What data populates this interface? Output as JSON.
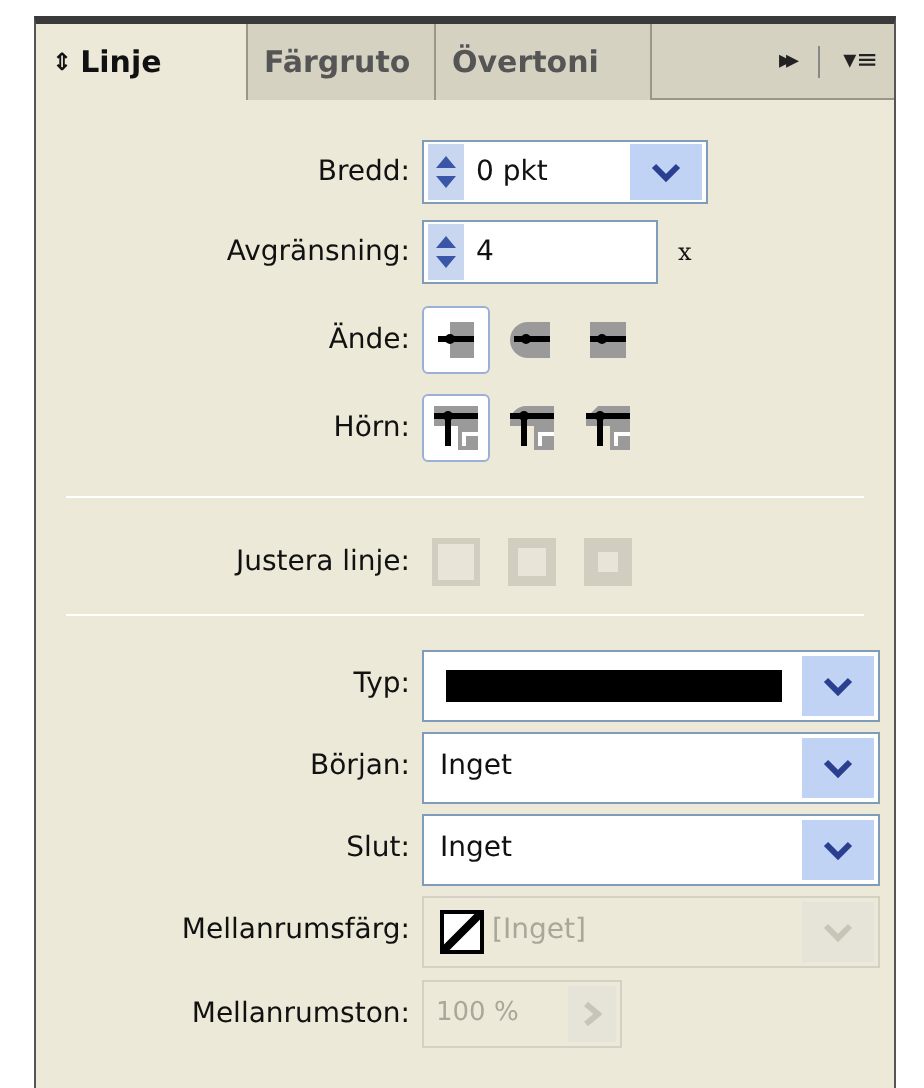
{
  "tabs": [
    {
      "label": "Linje",
      "selected": true,
      "icon": "⇕"
    },
    {
      "label": "Färgruto",
      "selected": false
    },
    {
      "label": "Övertoni",
      "selected": false
    }
  ],
  "tab_bar_icons": {
    "more": "▸▸",
    "menu": "▾≡"
  },
  "width": {
    "label": "Bredd:",
    "value": "0 pkt"
  },
  "miter": {
    "label": "Avgränsning:",
    "value": "4",
    "unit": "x"
  },
  "cap": {
    "label": "Ände:",
    "options": [
      {
        "selected": true
      },
      {
        "selected": false
      },
      {
        "selected": false
      }
    ]
  },
  "join": {
    "label": "Hörn:",
    "options": [
      {
        "selected": true
      },
      {
        "selected": false
      },
      {
        "selected": false
      }
    ]
  },
  "align": {
    "label": "Justera linje:",
    "options": [
      {
        "disabled": true
      },
      {
        "disabled": true
      },
      {
        "disabled": true
      }
    ]
  },
  "dropdowns": [
    {
      "label": "Typ:",
      "kind": "line",
      "disabled": false
    },
    {
      "label": "Början:",
      "kind": "text",
      "value": "Inget",
      "disabled": false
    },
    {
      "label": "Slut:",
      "kind": "text",
      "value": "Inget",
      "disabled": false
    },
    {
      "label": "Mellanrumsfärg:",
      "kind": "swatch",
      "value": "[Inget]",
      "disabled": true
    }
  ],
  "gap_tint": {
    "label": "Mellanrumston:",
    "value": "100 %",
    "disabled": true
  }
}
